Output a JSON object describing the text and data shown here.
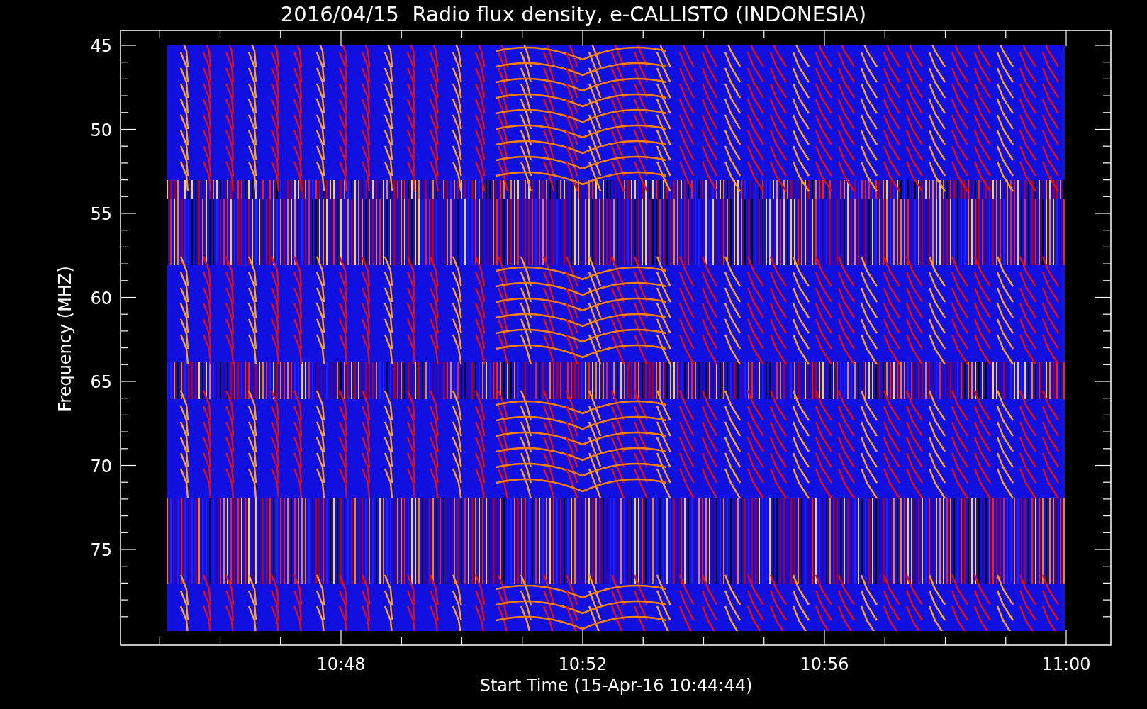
{
  "plot": {
    "title": "2016/04/15  Radio flux density, e-CALLISTO (INDONESIA)",
    "y_axis": {
      "label": "Frequency (MHZ)",
      "ticks": [
        "45",
        "50",
        "55",
        "60",
        "65",
        "70",
        "75"
      ]
    },
    "x_axis": {
      "label": "Start Time (15-Apr-16 10:44:44)",
      "ticks": [
        "10:48",
        "10:52",
        "10:56",
        "11:00"
      ]
    }
  }
}
